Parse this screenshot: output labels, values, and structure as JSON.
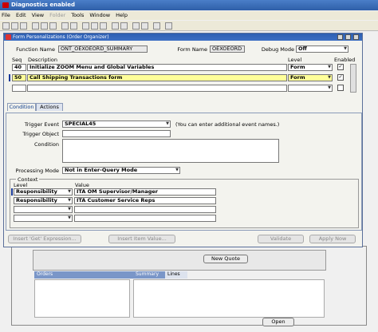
{
  "window": {
    "title": "Diagnostics enabled"
  },
  "menu": [
    "File",
    "Edit",
    "View",
    "Folder",
    "Tools",
    "Window",
    "Help"
  ],
  "form": {
    "title": "Form Personalizations (Order Organizer)",
    "function_name_label": "Function Name",
    "function_name_value": "ONT_OEXOEORD_SUMMARY",
    "form_name_label": "Form Name",
    "form_name_value": "OEXOEORD",
    "debug_mode_label": "Debug Mode",
    "debug_mode_value": "Off"
  },
  "rules": {
    "headers": {
      "seq": "Seq",
      "description": "Description",
      "level": "Level",
      "enabled": "Enabled"
    },
    "rows": [
      {
        "seq": "40",
        "description": "Initialize ZOOM Menu and Global Variables",
        "level": "Form",
        "enabled": "✓"
      },
      {
        "seq": "50",
        "description": "Call Shipping Transactions form",
        "level": "Form",
        "enabled": "✓"
      },
      {
        "seq": "",
        "description": "",
        "level": "",
        "enabled": ""
      }
    ]
  },
  "tabs": [
    "Condition",
    "Actions"
  ],
  "condition": {
    "trigger_event_label": "Trigger Event",
    "trigger_event_value": "SPECIAL45",
    "trigger_hint": "(You can enter additional event names.)",
    "trigger_object_label": "Trigger Object",
    "condition_label": "Condition",
    "processing_mode_label": "Processing Mode",
    "processing_mode_value": "Not in Enter-Query Mode"
  },
  "context": {
    "title": "Context",
    "level_header": "Level",
    "value_header": "Value",
    "rows": [
      {
        "level": "Responsibility",
        "value": "ITA OM Supervisor/Manager"
      },
      {
        "level": "Responsibility",
        "value": "ITA Customer Service Reps"
      },
      {
        "level": "",
        "value": ""
      },
      {
        "level": "",
        "value": ""
      }
    ]
  },
  "buttons": {
    "insert_get": "Insert 'Get' Expression...",
    "insert_item": "Insert Item Value...",
    "validate": "Validate",
    "apply_now": "Apply Now",
    "new_quote": "New Quote",
    "open": "Open"
  },
  "lower_tabs": {
    "orders": "Orders",
    "summary": "Summary",
    "lines": "Lines"
  }
}
